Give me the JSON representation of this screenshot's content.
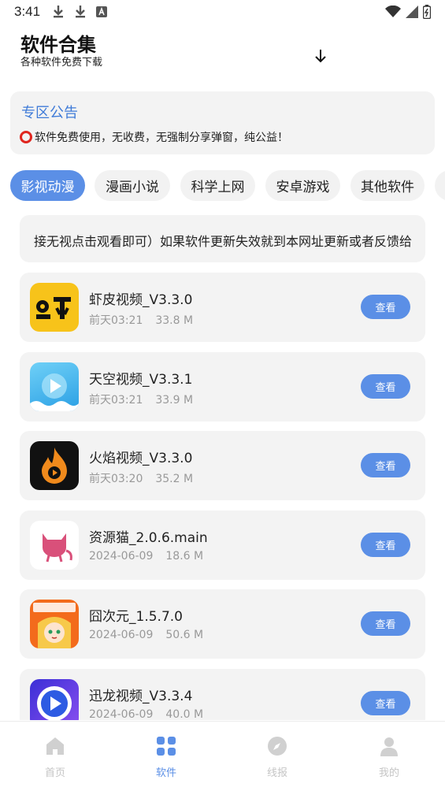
{
  "status_bar": {
    "time": "3:41"
  },
  "header": {
    "title": "软件合集",
    "subtitle": "各种软件免费下载"
  },
  "notice": {
    "title": "专区公告",
    "text": "软件免费使用，无收费，无强制分享弹窗，纯公益！"
  },
  "tabs": [
    {
      "label": "影视动漫",
      "active": true
    },
    {
      "label": "漫画小说",
      "active": false
    },
    {
      "label": "科学上网",
      "active": false
    },
    {
      "label": "安卓游戏",
      "active": false
    },
    {
      "label": "其他软件",
      "active": false
    }
  ],
  "marquee": {
    "text": "接无视点击观看即可）如果软件更新失效就到本网址更新或者反馈给"
  },
  "apps": [
    {
      "name": "虾皮视频_V3.3.0",
      "date": "前天03:21",
      "size": "33.8 M",
      "button": "查看",
      "icon": "shrimp-icon"
    },
    {
      "name": "天空视频_V3.3.1",
      "date": "前天03:21",
      "size": "33.9 M",
      "button": "查看",
      "icon": "sky-play-icon"
    },
    {
      "name": "火焰视频_V3.3.0",
      "date": "前天03:20",
      "size": "35.2 M",
      "button": "查看",
      "icon": "flame-icon"
    },
    {
      "name": "资源猫_2.0.6.main",
      "date": "2024-06-09",
      "size": "18.6 M",
      "button": "查看",
      "icon": "cat-icon"
    },
    {
      "name": "囧次元_1.5.7.0",
      "date": "2024-06-09",
      "size": "50.6 M",
      "button": "查看",
      "icon": "anime-girl-icon"
    },
    {
      "name": "迅龙视频_V3.3.4",
      "date": "2024-06-09",
      "size": "40.0 M",
      "button": "查看",
      "icon": "blue-play-icon"
    }
  ],
  "bottom_nav": [
    {
      "label": "首页",
      "icon": "home-icon",
      "active": false
    },
    {
      "label": "软件",
      "icon": "grid-icon",
      "active": true
    },
    {
      "label": "线报",
      "icon": "compass-icon",
      "active": false
    },
    {
      "label": "我的",
      "icon": "user-icon",
      "active": false
    }
  ],
  "colors": {
    "accent": "#5b8fe6",
    "notice_title": "#3f7bd8",
    "card_bg": "#f3f3f3"
  }
}
